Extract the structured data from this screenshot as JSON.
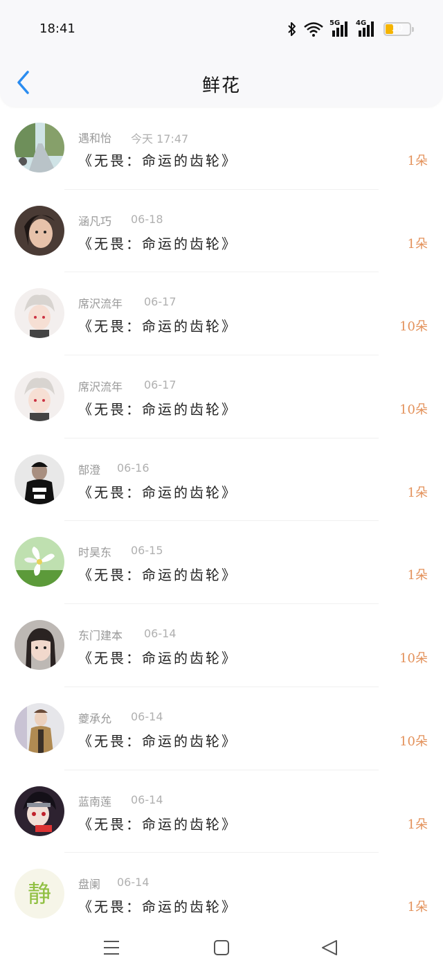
{
  "status_bar": {
    "time": "18:41",
    "network_1": "5G",
    "network_2": "4G",
    "battery_level": "30",
    "battery_color": "#f5b400"
  },
  "header": {
    "title": "鲜花",
    "back_icon": "chevron-left-icon",
    "accent_color": "#2a8cf0"
  },
  "gifts": [
    {
      "user": "遇和怡",
      "date": "今天 17:47",
      "book": "《无畏：命运的齿轮》",
      "quantity": "1朵"
    },
    {
      "user": "涵凡巧",
      "date": "06-18",
      "book": "《无畏：命运的齿轮》",
      "quantity": "1朵"
    },
    {
      "user": "席沢流年",
      "date": "06-17",
      "book": "《无畏：命运的齿轮》",
      "quantity": "10朵"
    },
    {
      "user": "席沢流年",
      "date": "06-17",
      "book": "《无畏：命运的齿轮》",
      "quantity": "10朵"
    },
    {
      "user": "郜澄",
      "date": "06-16",
      "book": "《无畏：命运的齿轮》",
      "quantity": "1朵"
    },
    {
      "user": "时昊东",
      "date": "06-15",
      "book": "《无畏：命运的齿轮》",
      "quantity": "1朵"
    },
    {
      "user": "东门建本",
      "date": "06-14",
      "book": "《无畏：命运的齿轮》",
      "quantity": "10朵"
    },
    {
      "user": "夔承允",
      "date": "06-14",
      "book": "《无畏：命运的齿轮》",
      "quantity": "10朵"
    },
    {
      "user": "蓝南莲",
      "date": "06-14",
      "book": "《无畏：命运的齿轮》",
      "quantity": "1朵"
    },
    {
      "user": "盘阑",
      "date": "06-14",
      "book": "《无畏：命运的齿轮》",
      "quantity": "1朵"
    }
  ],
  "avatar_logo_text": "静",
  "nav_bar": {
    "menu_icon": "menu-icon",
    "home_icon": "home-square-icon",
    "back_icon": "back-triangle-icon"
  }
}
